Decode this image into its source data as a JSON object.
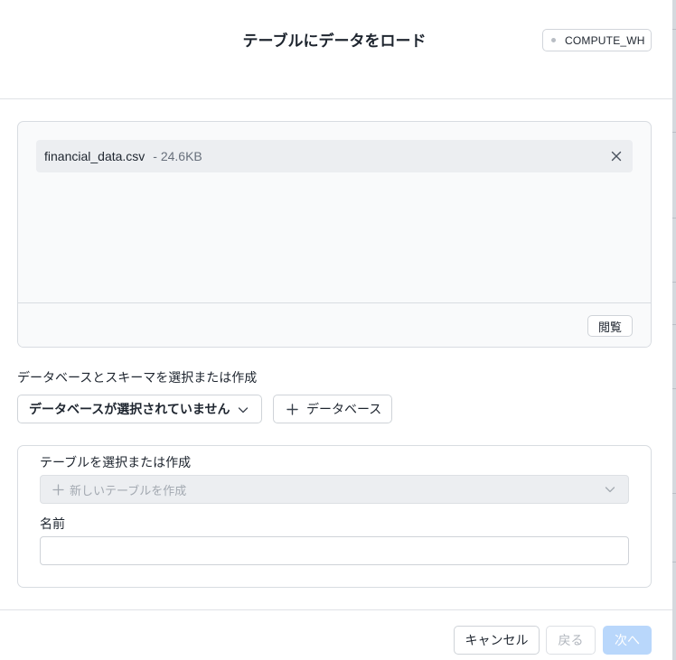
{
  "header": {
    "title": "テーブルにデータをロード",
    "warehouse": "COMPUTE_WH"
  },
  "upload": {
    "file_name": "financial_data.csv",
    "file_size": "- 24.6KB",
    "browse_label": "閲覧"
  },
  "database": {
    "label": "データベースとスキーマを選択または作成",
    "select_value": "データベースが選択されていません",
    "add_label": "データベース"
  },
  "table": {
    "label": "テーブルを選択または作成",
    "select_placeholder": "新しいテーブルを作成",
    "name_label": "名前",
    "name_value": ""
  },
  "footer": {
    "cancel_label": "キャンセル",
    "back_label": "戻る",
    "next_label": "次へ"
  },
  "colors": {
    "primary_disabled": "#b9d7fb",
    "text": "#1e252f",
    "muted_text": "#68707c",
    "border": "#cfd3d8"
  },
  "icons": [
    "close-icon",
    "chevron-down-icon",
    "plus-icon",
    "status-dot-icon"
  ]
}
